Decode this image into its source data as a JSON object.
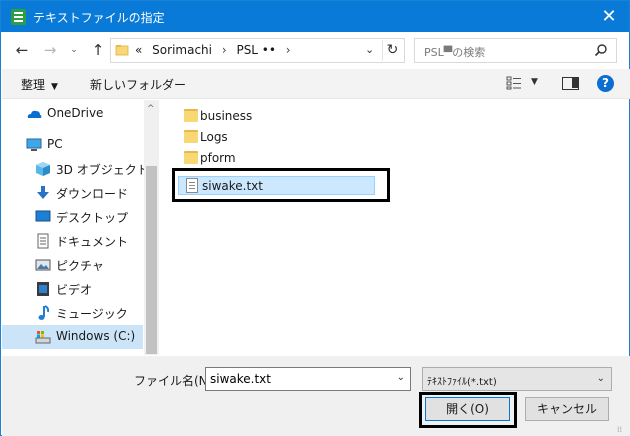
{
  "window": {
    "title": "テキストファイルの指定",
    "close_label": "✕",
    "accent": "#0a7ad8"
  },
  "nav": {
    "back": "←",
    "forward": "→",
    "recent": "⌄",
    "up": "↑"
  },
  "address": {
    "prefix": "«",
    "segments": [
      "Sorimachi",
      "PSL ••"
    ],
    "separator": "›",
    "dropdown": "⌄",
    "refresh": "↻"
  },
  "search": {
    "placeholder": "PSL▀の検索"
  },
  "toolbar": {
    "organize": "整理",
    "organize_caret": "▼",
    "new_folder": "新しいフォルダー",
    "view_caret": "▼",
    "help": "?"
  },
  "navpane": {
    "items": [
      {
        "label": "OneDrive",
        "icon": "cloud-icon"
      },
      {
        "label": "PC",
        "icon": "computer-icon"
      },
      {
        "label": "3D オブジェクト",
        "icon": "cube-3d-icon"
      },
      {
        "label": "ダウンロード",
        "icon": "download-arrow-icon"
      },
      {
        "label": "デスクトップ",
        "icon": "desktop-icon"
      },
      {
        "label": "ドキュメント",
        "icon": "document-icon"
      },
      {
        "label": "ピクチャ",
        "icon": "picture-icon"
      },
      {
        "label": "ビデオ",
        "icon": "video-icon"
      },
      {
        "label": "ミュージック",
        "icon": "music-note-icon"
      },
      {
        "label": "Windows (C:)",
        "icon": "drive-icon",
        "selected": true
      }
    ],
    "scroll_up": "^"
  },
  "files": [
    {
      "name": "business",
      "type": "folder"
    },
    {
      "name": "Logs",
      "type": "folder"
    },
    {
      "name": "pform",
      "type": "folder"
    },
    {
      "name": "siwake.txt",
      "type": "text",
      "selected": true
    }
  ],
  "footer": {
    "filename_label": "ファイル名(N):",
    "filename_value": "siwake.txt",
    "filetype": "ﾃｷｽﾄﾌｧｲﾙ(*.txt)",
    "caret": "⌄",
    "open": "開く(O)",
    "cancel": "キャンセル",
    "grip": "⁞⁞"
  }
}
